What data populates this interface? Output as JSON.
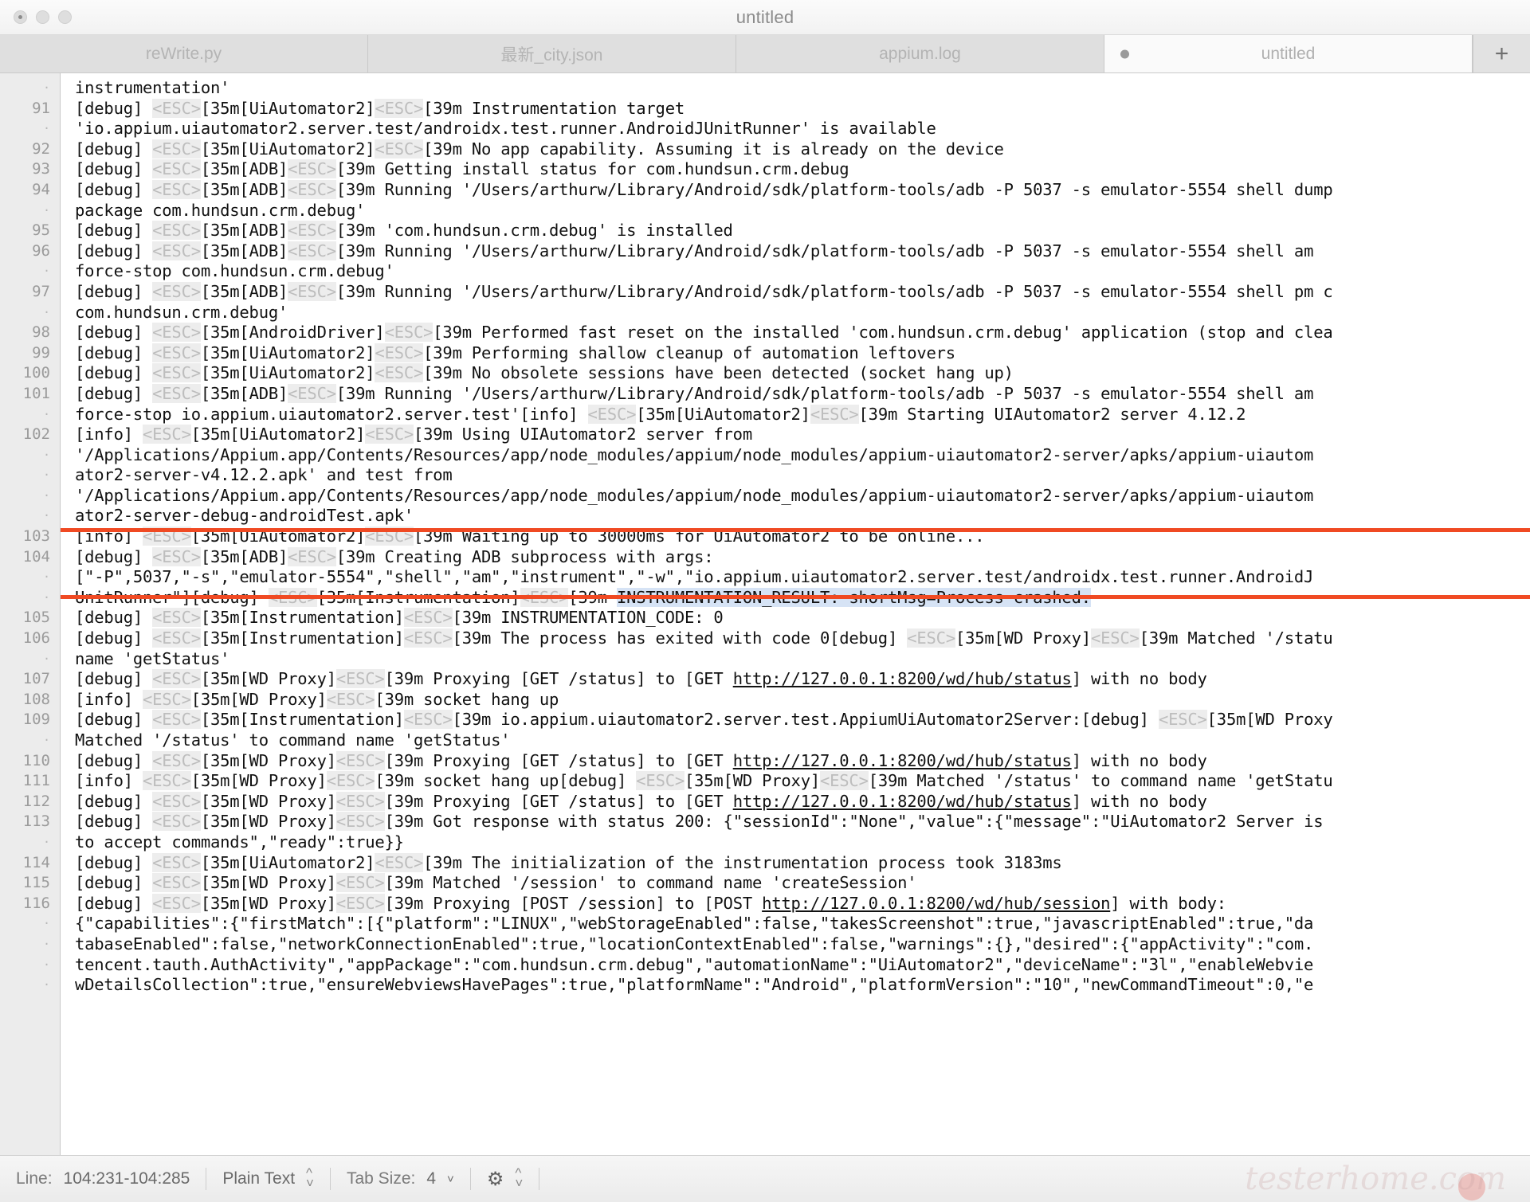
{
  "window": {
    "title": "untitled",
    "traffic_lights": [
      "close",
      "minimize",
      "maximize"
    ]
  },
  "tabs": [
    {
      "label": "reWrite.py",
      "active": false,
      "modified": false
    },
    {
      "label": "最新_city.json",
      "active": false,
      "modified": false
    },
    {
      "label": "appium.log",
      "active": false,
      "modified": false
    },
    {
      "label": "untitled",
      "active": true,
      "modified": true
    }
  ],
  "new_tab_button": "+",
  "editor": {
    "lines": [
      {
        "num": "·",
        "segments": [
          {
            "t": "instrumentation'"
          }
        ]
      },
      {
        "num": "91",
        "segments": [
          {
            "t": "[debug] "
          },
          {
            "t": "<ESC>",
            "c": "esc"
          },
          {
            "t": "[35m[UiAutomator2]"
          },
          {
            "t": "<ESC>",
            "c": "esc"
          },
          {
            "t": "[39m Instrumentation target"
          }
        ]
      },
      {
        "num": "·",
        "segments": [
          {
            "t": "'io.appium.uiautomator2.server.test/androidx.test.runner.AndroidJUnitRunner' is available"
          }
        ]
      },
      {
        "num": "92",
        "segments": [
          {
            "t": "[debug] "
          },
          {
            "t": "<ESC>",
            "c": "esc"
          },
          {
            "t": "[35m[UiAutomator2]"
          },
          {
            "t": "<ESC>",
            "c": "esc"
          },
          {
            "t": "[39m No app capability. Assuming it is already on the device"
          }
        ]
      },
      {
        "num": "93",
        "segments": [
          {
            "t": "[debug] "
          },
          {
            "t": "<ESC>",
            "c": "esc"
          },
          {
            "t": "[35m[ADB]"
          },
          {
            "t": "<ESC>",
            "c": "esc"
          },
          {
            "t": "[39m Getting install status for com.hundsun.crm.debug"
          }
        ]
      },
      {
        "num": "94",
        "segments": [
          {
            "t": "[debug] "
          },
          {
            "t": "<ESC>",
            "c": "esc"
          },
          {
            "t": "[35m[ADB]"
          },
          {
            "t": "<ESC>",
            "c": "esc"
          },
          {
            "t": "[39m Running '/Users/arthurw/Library/Android/sdk/platform-tools/adb -P 5037 -s emulator-5554 shell dump"
          }
        ]
      },
      {
        "num": "·",
        "segments": [
          {
            "t": "package com.hundsun.crm.debug'"
          }
        ]
      },
      {
        "num": "95",
        "segments": [
          {
            "t": "[debug] "
          },
          {
            "t": "<ESC>",
            "c": "esc"
          },
          {
            "t": "[35m[ADB]"
          },
          {
            "t": "<ESC>",
            "c": "esc"
          },
          {
            "t": "[39m 'com.hundsun.crm.debug' is installed"
          }
        ]
      },
      {
        "num": "96",
        "segments": [
          {
            "t": "[debug] "
          },
          {
            "t": "<ESC>",
            "c": "esc"
          },
          {
            "t": "[35m[ADB]"
          },
          {
            "t": "<ESC>",
            "c": "esc"
          },
          {
            "t": "[39m Running '/Users/arthurw/Library/Android/sdk/platform-tools/adb -P 5037 -s emulator-5554 shell am"
          }
        ]
      },
      {
        "num": "·",
        "segments": [
          {
            "t": "force-stop com.hundsun.crm.debug'"
          }
        ]
      },
      {
        "num": "97",
        "segments": [
          {
            "t": "[debug] "
          },
          {
            "t": "<ESC>",
            "c": "esc"
          },
          {
            "t": "[35m[ADB]"
          },
          {
            "t": "<ESC>",
            "c": "esc"
          },
          {
            "t": "[39m Running '/Users/arthurw/Library/Android/sdk/platform-tools/adb -P 5037 -s emulator-5554 shell pm c"
          }
        ]
      },
      {
        "num": "·",
        "segments": [
          {
            "t": "com.hundsun.crm.debug'"
          }
        ]
      },
      {
        "num": "98",
        "segments": [
          {
            "t": "[debug] "
          },
          {
            "t": "<ESC>",
            "c": "esc"
          },
          {
            "t": "[35m[AndroidDriver]"
          },
          {
            "t": "<ESC>",
            "c": "esc"
          },
          {
            "t": "[39m Performed fast reset on the installed 'com.hundsun.crm.debug' application (stop and clea"
          }
        ]
      },
      {
        "num": "99",
        "segments": [
          {
            "t": "[debug] "
          },
          {
            "t": "<ESC>",
            "c": "esc"
          },
          {
            "t": "[35m[UiAutomator2]"
          },
          {
            "t": "<ESC>",
            "c": "esc"
          },
          {
            "t": "[39m Performing shallow cleanup of automation leftovers"
          }
        ]
      },
      {
        "num": "100",
        "segments": [
          {
            "t": "[debug] "
          },
          {
            "t": "<ESC>",
            "c": "esc"
          },
          {
            "t": "[35m[UiAutomator2]"
          },
          {
            "t": "<ESC>",
            "c": "esc"
          },
          {
            "t": "[39m No obsolete sessions have been detected (socket hang up)"
          }
        ]
      },
      {
        "num": "101",
        "segments": [
          {
            "t": "[debug] "
          },
          {
            "t": "<ESC>",
            "c": "esc"
          },
          {
            "t": "[35m[ADB]"
          },
          {
            "t": "<ESC>",
            "c": "esc"
          },
          {
            "t": "[39m Running '/Users/arthurw/Library/Android/sdk/platform-tools/adb -P 5037 -s emulator-5554 shell am"
          }
        ]
      },
      {
        "num": "·",
        "segments": [
          {
            "t": "force-stop io.appium.uiautomator2.server.test'[info] "
          },
          {
            "t": "<ESC>",
            "c": "esc"
          },
          {
            "t": "[35m[UiAutomator2]"
          },
          {
            "t": "<ESC>",
            "c": "esc"
          },
          {
            "t": "[39m Starting UIAutomator2 server 4.12.2"
          }
        ]
      },
      {
        "num": "102",
        "segments": [
          {
            "t": "[info] "
          },
          {
            "t": "<ESC>",
            "c": "esc"
          },
          {
            "t": "[35m[UiAutomator2]"
          },
          {
            "t": "<ESC>",
            "c": "esc"
          },
          {
            "t": "[39m Using UIAutomator2 server from"
          }
        ]
      },
      {
        "num": "·",
        "segments": [
          {
            "t": "'/Applications/Appium.app/Contents/Resources/app/node_modules/appium/node_modules/appium-uiautomator2-server/apks/appium-uiautom"
          }
        ]
      },
      {
        "num": "·",
        "segments": [
          {
            "t": "ator2-server-v4.12.2.apk' and test from"
          }
        ]
      },
      {
        "num": "·",
        "segments": [
          {
            "t": "'/Applications/Appium.app/Contents/Resources/app/node_modules/appium/node_modules/appium-uiautomator2-server/apks/appium-uiautom"
          }
        ]
      },
      {
        "num": "·",
        "segments": [
          {
            "t": "ator2-server-debug-androidTest.apk'"
          }
        ]
      },
      {
        "num": "103",
        "segments": [
          {
            "t": "[info] "
          },
          {
            "t": "<ESC>",
            "c": "esc"
          },
          {
            "t": "[35m[UiAutomator2]"
          },
          {
            "t": "<ESC>",
            "c": "esc"
          },
          {
            "t": "[39m Waiting up to 30000ms for UiAutomator2 to be online..."
          }
        ]
      },
      {
        "num": "104",
        "segments": [
          {
            "t": "[debug] "
          },
          {
            "t": "<ESC>",
            "c": "esc"
          },
          {
            "t": "[35m[ADB]"
          },
          {
            "t": "<ESC>",
            "c": "esc"
          },
          {
            "t": "[39m Creating ADB subprocess with args:"
          }
        ]
      },
      {
        "num": "·",
        "segments": [
          {
            "t": "[\"-P\",5037,\"-s\",\"emulator-5554\",\"shell\",\"am\",\"instrument\",\"-w\",\"io.appium.uiautomator2.server.test/androidx.test.runner.AndroidJ"
          }
        ]
      },
      {
        "num": "·",
        "segments": [
          {
            "t": "UnitRunner\"][debug] "
          },
          {
            "t": "<ESC>",
            "c": "esc"
          },
          {
            "t": "[35m[Instrumentation]"
          },
          {
            "t": "<ESC>",
            "c": "esc"
          },
          {
            "t": "[39m "
          },
          {
            "t": "INSTRUMENTATION_RESULT: shortMsg=Process crashed.",
            "c": "sel"
          }
        ]
      },
      {
        "num": "105",
        "segments": [
          {
            "t": "[debug] "
          },
          {
            "t": "<ESC>",
            "c": "esc"
          },
          {
            "t": "[35m[Instrumentation]"
          },
          {
            "t": "<ESC>",
            "c": "esc"
          },
          {
            "t": "[39m INSTRUMENTATION_CODE: 0"
          }
        ]
      },
      {
        "num": "106",
        "segments": [
          {
            "t": "[debug] "
          },
          {
            "t": "<ESC>",
            "c": "esc"
          },
          {
            "t": "[35m[Instrumentation]"
          },
          {
            "t": "<ESC>",
            "c": "esc"
          },
          {
            "t": "[39m The process has exited with code 0[debug] "
          },
          {
            "t": "<ESC>",
            "c": "esc"
          },
          {
            "t": "[35m[WD Proxy]"
          },
          {
            "t": "<ESC>",
            "c": "esc"
          },
          {
            "t": "[39m Matched '/statu"
          }
        ]
      },
      {
        "num": "·",
        "segments": [
          {
            "t": "name 'getStatus'"
          }
        ]
      },
      {
        "num": "107",
        "segments": [
          {
            "t": "[debug] "
          },
          {
            "t": "<ESC>",
            "c": "esc"
          },
          {
            "t": "[35m[WD Proxy]"
          },
          {
            "t": "<ESC>",
            "c": "esc"
          },
          {
            "t": "[39m Proxying [GET /status] to [GET "
          },
          {
            "t": "http://127.0.0.1:8200/wd/hub/status",
            "c": "lnk"
          },
          {
            "t": "] with no body"
          }
        ]
      },
      {
        "num": "108",
        "segments": [
          {
            "t": "[info] "
          },
          {
            "t": "<ESC>",
            "c": "esc"
          },
          {
            "t": "[35m[WD Proxy]"
          },
          {
            "t": "<ESC>",
            "c": "esc"
          },
          {
            "t": "[39m socket hang up"
          }
        ]
      },
      {
        "num": "109",
        "segments": [
          {
            "t": "[debug] "
          },
          {
            "t": "<ESC>",
            "c": "esc"
          },
          {
            "t": "[35m[Instrumentation]"
          },
          {
            "t": "<ESC>",
            "c": "esc"
          },
          {
            "t": "[39m io.appium.uiautomator2.server.test.AppiumUiAutomator2Server:[debug] "
          },
          {
            "t": "<ESC>",
            "c": "esc"
          },
          {
            "t": "[35m[WD Proxy"
          }
        ]
      },
      {
        "num": "·",
        "segments": [
          {
            "t": "Matched '/status' to command name 'getStatus'"
          }
        ]
      },
      {
        "num": "110",
        "segments": [
          {
            "t": "[debug] "
          },
          {
            "t": "<ESC>",
            "c": "esc"
          },
          {
            "t": "[35m[WD Proxy]"
          },
          {
            "t": "<ESC>",
            "c": "esc"
          },
          {
            "t": "[39m Proxying [GET /status] to [GET "
          },
          {
            "t": "http://127.0.0.1:8200/wd/hub/status",
            "c": "lnk"
          },
          {
            "t": "] with no body"
          }
        ]
      },
      {
        "num": "111",
        "segments": [
          {
            "t": "[info] "
          },
          {
            "t": "<ESC>",
            "c": "esc"
          },
          {
            "t": "[35m[WD Proxy]"
          },
          {
            "t": "<ESC>",
            "c": "esc"
          },
          {
            "t": "[39m socket hang up[debug] "
          },
          {
            "t": "<ESC>",
            "c": "esc"
          },
          {
            "t": "[35m[WD Proxy]"
          },
          {
            "t": "<ESC>",
            "c": "esc"
          },
          {
            "t": "[39m Matched '/status' to command name 'getStatu"
          }
        ]
      },
      {
        "num": "112",
        "segments": [
          {
            "t": "[debug] "
          },
          {
            "t": "<ESC>",
            "c": "esc"
          },
          {
            "t": "[35m[WD Proxy]"
          },
          {
            "t": "<ESC>",
            "c": "esc"
          },
          {
            "t": "[39m Proxying [GET /status] to [GET "
          },
          {
            "t": "http://127.0.0.1:8200/wd/hub/status",
            "c": "lnk"
          },
          {
            "t": "] with no body"
          }
        ]
      },
      {
        "num": "113",
        "segments": [
          {
            "t": "[debug] "
          },
          {
            "t": "<ESC>",
            "c": "esc"
          },
          {
            "t": "[35m[WD Proxy]"
          },
          {
            "t": "<ESC>",
            "c": "esc"
          },
          {
            "t": "[39m Got response with status 200: {\"sessionId\":\"None\",\"value\":{\"message\":\"UiAutomator2 Server is "
          }
        ]
      },
      {
        "num": "·",
        "segments": [
          {
            "t": "to accept commands\",\"ready\":true}}"
          }
        ]
      },
      {
        "num": "114",
        "segments": [
          {
            "t": "[debug] "
          },
          {
            "t": "<ESC>",
            "c": "esc"
          },
          {
            "t": "[35m[UiAutomator2]"
          },
          {
            "t": "<ESC>",
            "c": "esc"
          },
          {
            "t": "[39m The initialization of the instrumentation process took 3183ms"
          }
        ]
      },
      {
        "num": "115",
        "segments": [
          {
            "t": "[debug] "
          },
          {
            "t": "<ESC>",
            "c": "esc"
          },
          {
            "t": "[35m[WD Proxy]"
          },
          {
            "t": "<ESC>",
            "c": "esc"
          },
          {
            "t": "[39m Matched '/session' to command name 'createSession'"
          }
        ]
      },
      {
        "num": "116",
        "segments": [
          {
            "t": "[debug] "
          },
          {
            "t": "<ESC>",
            "c": "esc"
          },
          {
            "t": "[35m[WD Proxy]"
          },
          {
            "t": "<ESC>",
            "c": "esc"
          },
          {
            "t": "[39m Proxying [POST /session] to [POST "
          },
          {
            "t": "http://127.0.0.1:8200/wd/hub/session",
            "c": "lnk"
          },
          {
            "t": "] with body:"
          }
        ]
      },
      {
        "num": "·",
        "segments": [
          {
            "t": "{\"capabilities\":{\"firstMatch\":[{\"platform\":\"LINUX\",\"webStorageEnabled\":false,\"takesScreenshot\":true,\"javascriptEnabled\":true,\"da"
          }
        ]
      },
      {
        "num": "·",
        "segments": [
          {
            "t": "tabaseEnabled\":false,\"networkConnectionEnabled\":true,\"locationContextEnabled\":false,\"warnings\":{},\"desired\":{\"appActivity\":\"com."
          }
        ]
      },
      {
        "num": "·",
        "segments": [
          {
            "t": "tencent.tauth.AuthActivity\",\"appPackage\":\"com.hundsun.crm.debug\",\"automationName\":\"UiAutomator2\",\"deviceName\":\"3l\",\"enableWebvie"
          }
        ]
      },
      {
        "num": "·",
        "segments": [
          {
            "t": "wDetailsCollection\":true,\"ensureWebviewsHavePages\":true,\"platformName\":\"Android\",\"platformVersion\":\"10\",\"newCommandTimeout\":0,\"e"
          }
        ]
      }
    ],
    "annotation": {
      "color": "#f04a23",
      "start_line_index": 23,
      "line_count": 3
    },
    "selection": {
      "text": "INSTRUMENTATION_RESULT: shortMsg=Process crashed.",
      "color": "#d6e3f5"
    }
  },
  "statusbar": {
    "line_label": "Line:",
    "line_value": "104:231-104:285",
    "syntax": "Plain Text",
    "tab_size_label": "Tab Size:",
    "tab_size_value": "4",
    "gear_icon": "gear-icon",
    "watermark": "testerhome.com"
  }
}
